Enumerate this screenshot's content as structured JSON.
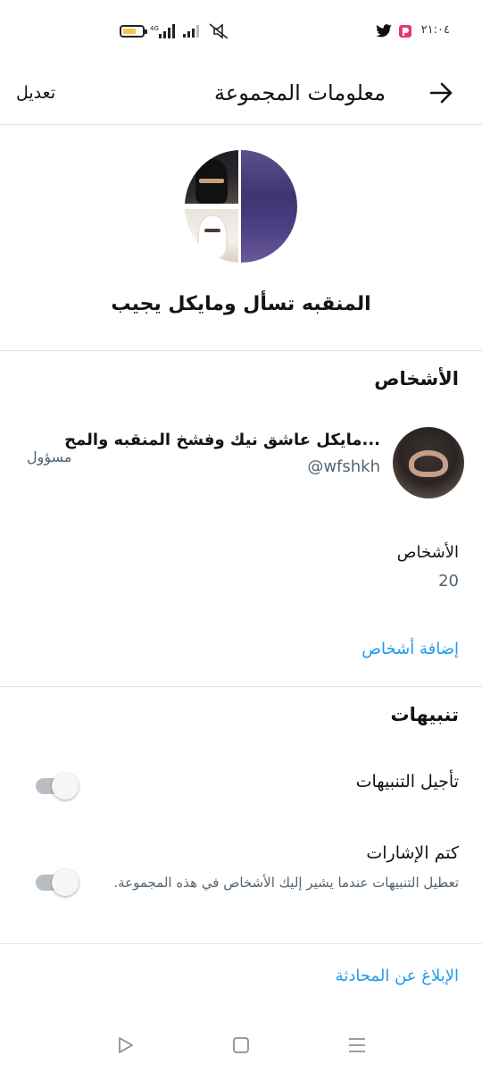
{
  "status_bar": {
    "time": "٢١:٠٤",
    "network_text": "4G",
    "colors": {
      "battery_fill": "#f2c94c"
    },
    "icons": [
      "battery-icon",
      "signal-icon",
      "signal-icon-2",
      "mute-icon",
      "pocket-app-icon",
      "twitter-icon"
    ]
  },
  "header": {
    "title": "معلومات المجموعة",
    "edit_label": "تعديل"
  },
  "group": {
    "name": "المنقبه تسأل ومايكل يجيب"
  },
  "people_section": {
    "title": "الأشخاص",
    "member": {
      "name": "مايكل عاشق نيك وفشخ المنقبه والمح...",
      "handle": "@wfshkh",
      "role": "مسؤول"
    },
    "count_label": "الأشخاص",
    "count_value": "20",
    "add_people_label": "إضافة أشخاص"
  },
  "notifications_section": {
    "title": "تنبيهات",
    "snooze": {
      "label": "تأجيل التنبيهات",
      "enabled": false
    },
    "mute_mentions": {
      "label": "كتم الإشارات",
      "description": "تعطيل التنبيهات عندما يشير إليك الأشخاص في هذه المجموعة.",
      "enabled": false
    }
  },
  "report_label": "الإبلاغ عن المحادثة",
  "colors": {
    "accent": "#1d9bf0",
    "secondary_text": "#536471",
    "divider": "#dfe3e6"
  },
  "nav": {
    "icons": [
      "back-triangle-icon",
      "home-square-icon",
      "menu-lines-icon"
    ]
  }
}
